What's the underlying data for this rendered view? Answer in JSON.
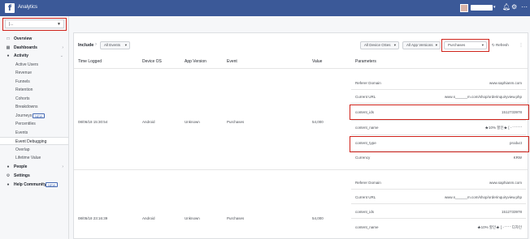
{
  "topbar": {
    "app_title": "Analytics",
    "user_caret": "▾"
  },
  "sidebar": {
    "account_value": "|...",
    "items": [
      {
        "label": "Overview",
        "icon": "□"
      },
      {
        "label": "Dashboards",
        "icon": "▦",
        "arrow": "›"
      },
      {
        "label": "Activity",
        "icon": "●",
        "arrow": "⌄"
      },
      {
        "label": "Active Users"
      },
      {
        "label": "Revenue"
      },
      {
        "label": "Funnels"
      },
      {
        "label": "Retention"
      },
      {
        "label": "Cohorts"
      },
      {
        "label": "Breakdowns"
      },
      {
        "label": "Journeys",
        "badge": "NEW"
      },
      {
        "label": "Percentiles"
      },
      {
        "label": "Events"
      },
      {
        "label": "Event Debugging"
      },
      {
        "label": "Overlap"
      },
      {
        "label": "Lifetime Value"
      },
      {
        "label": "People",
        "icon": "●",
        "arrow": "›"
      },
      {
        "label": "Settings",
        "icon": "⚙"
      },
      {
        "label": "Help Community",
        "icon": "●",
        "badge": "NEW"
      }
    ]
  },
  "toolbar": {
    "include_label": "Include",
    "crumb_sep": "›",
    "events_filter": "All Events",
    "device_filter": "All Device OSes",
    "app_version_filter": "All App Versions",
    "event_filter": "Purchases",
    "refresh_label": "Refresh",
    "refresh_icon": "↻",
    "more_icon": "⋮",
    "caret": "▾"
  },
  "table": {
    "headers": [
      "Time Logged",
      "Device OS",
      "App Version",
      "Event",
      "Value",
      "Parameters"
    ],
    "rows": [
      {
        "time": "08/06/18 15:30:54",
        "device": "Android",
        "app_version": "Unknown",
        "event": "Purchases",
        "value": "54,000",
        "params": [
          {
            "name": "Referer Domain",
            "value": "www.saphianm.com"
          },
          {
            "name": "Current URL",
            "value": "www.s______m.com/shop/orderinquiryview.php"
          },
          {
            "name": "content_ids",
            "value": "1512733978"
          },
          {
            "name": "content_name",
            "value": "★10% 할인★ [ - ' ' ' ' ' '"
          },
          {
            "name": "content_type",
            "value": "product"
          },
          {
            "name": "Currency",
            "value": "KRW"
          }
        ]
      },
      {
        "time": "08/05/18 23:16:39",
        "device": "Android",
        "app_version": "Unknown",
        "event": "Purchases",
        "value": "54,000",
        "params": [
          {
            "name": "Referer Domain",
            "value": "www.saphianm.com"
          },
          {
            "name": "Current URL",
            "value": "www.s______m.com/shop/orderinquiryview.php"
          },
          {
            "name": "content_ids",
            "value": "1512733978"
          },
          {
            "name": "content_name",
            "value": "★10% 할인★ [ - ' ' ' ' 디자인"
          }
        ]
      }
    ]
  }
}
